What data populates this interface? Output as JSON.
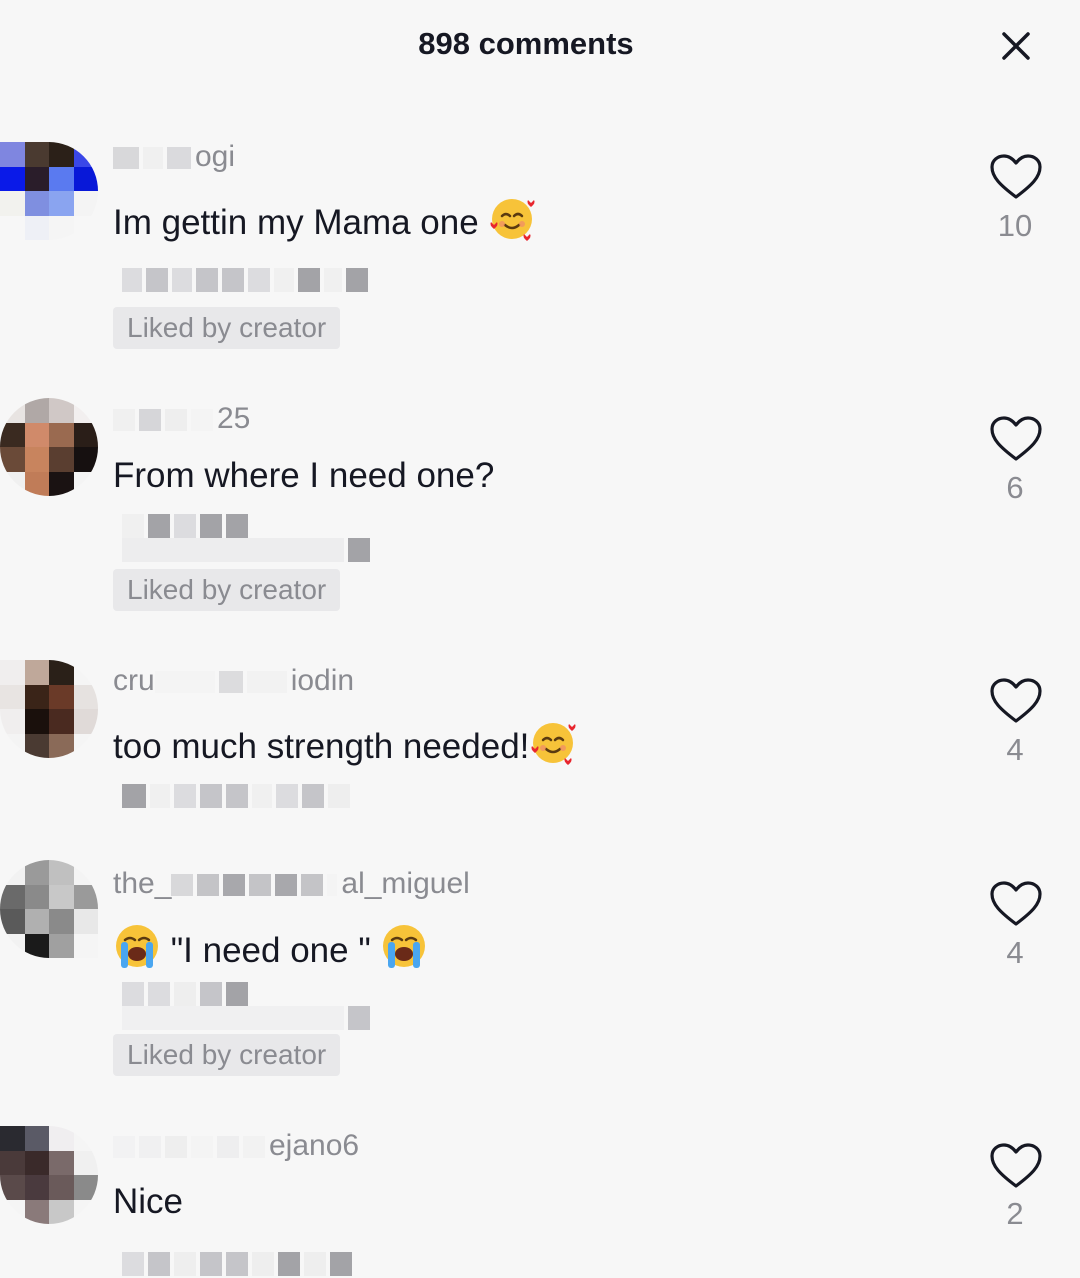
{
  "header": {
    "title": "898 comments",
    "close_icon": "close-icon"
  },
  "comments": [
    {
      "username_visible": "ogi",
      "text": "Im gettin my Mama one",
      "emoji": "smiling-face-with-hearts",
      "liked_by_creator": "Liked by creator",
      "likes": "10"
    },
    {
      "username_visible": "25",
      "text": "From where I need one?",
      "liked_by_creator": "Liked by creator",
      "likes": "6"
    },
    {
      "username_prefix": "cru",
      "username_suffix": "iodin",
      "text": "too much strength needed!",
      "emoji": "smiling-face-with-hearts",
      "likes": "4"
    },
    {
      "username_prefix": "the_",
      "username_suffix": "al_miguel",
      "text": "\"I need one \"",
      "emoji": "loudly-crying-face",
      "liked_by_creator": "Liked by creator",
      "likes": "4"
    },
    {
      "username_visible": "ejano6",
      "text": "Nice",
      "likes": "2"
    }
  ],
  "colors": {
    "background": "#f7f7f7",
    "primary_text": "#161823",
    "secondary_text": "#8a8b91",
    "badge_bg": "#e8e8ea"
  }
}
